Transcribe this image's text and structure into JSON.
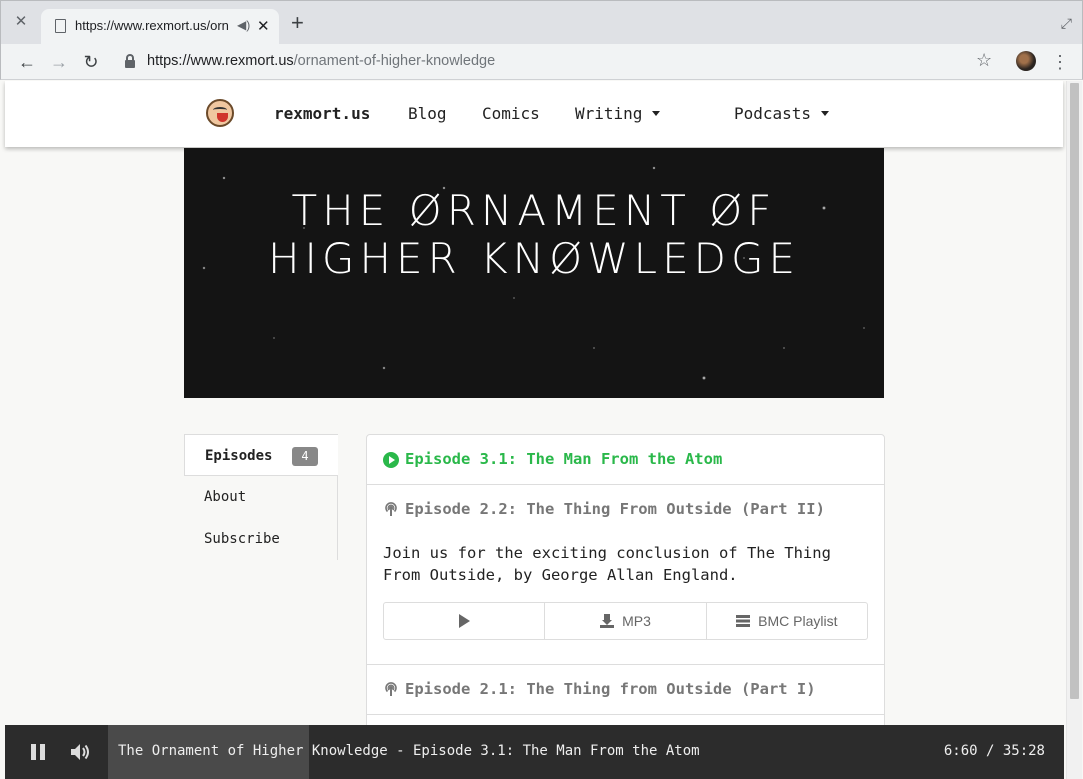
{
  "browser": {
    "tab_title": "https://www.rexmort.us/ornament-of-higher-knowledge",
    "url_host": "https://www.rexmort.us",
    "url_path": "/ornament-of-higher-knowledge",
    "icons": [
      "close-icon",
      "document-icon",
      "speaker-icon",
      "plus-icon",
      "maximize-icon",
      "back-icon",
      "forward-icon",
      "reload-icon",
      "lock-icon",
      "star-icon",
      "profile-avatar",
      "kebab-menu-icon"
    ]
  },
  "site_nav": {
    "brand": "rexmort.us",
    "items": [
      {
        "label": "Blog"
      },
      {
        "label": "Comics"
      },
      {
        "label": "Writing"
      },
      {
        "label": "Podcasts"
      }
    ]
  },
  "banner": {
    "title_line1": "The Ørnament øf",
    "title_line2": "Higher Knøwledge"
  },
  "sidebar": {
    "items": [
      {
        "label": "Episodes",
        "badge": "4"
      },
      {
        "label": "About"
      },
      {
        "label": "Subscribe"
      }
    ]
  },
  "episodes": [
    {
      "title": "Episode 3.1: The Man From the Atom",
      "state": "playing"
    },
    {
      "title": "Episode 2.2: The Thing From Outside (Part II)",
      "description": "Join us for the exciting conclusion of The Thing From Outside, by George Allan England.",
      "buttons": {
        "mp3": "MP3",
        "playlist": "BMC Playlist"
      }
    },
    {
      "title": "Episode 2.1: The Thing from Outside (Part I)"
    }
  ],
  "player": {
    "now_playing": "The Ornament of Higher Knowledge - Episode 3.1: The Man From the Atom",
    "time": "6:60 / 35:28",
    "progress_fraction": 0.19
  },
  "colors": {
    "accent": "#2ab84a",
    "player_bg": "#2c2c2c"
  }
}
